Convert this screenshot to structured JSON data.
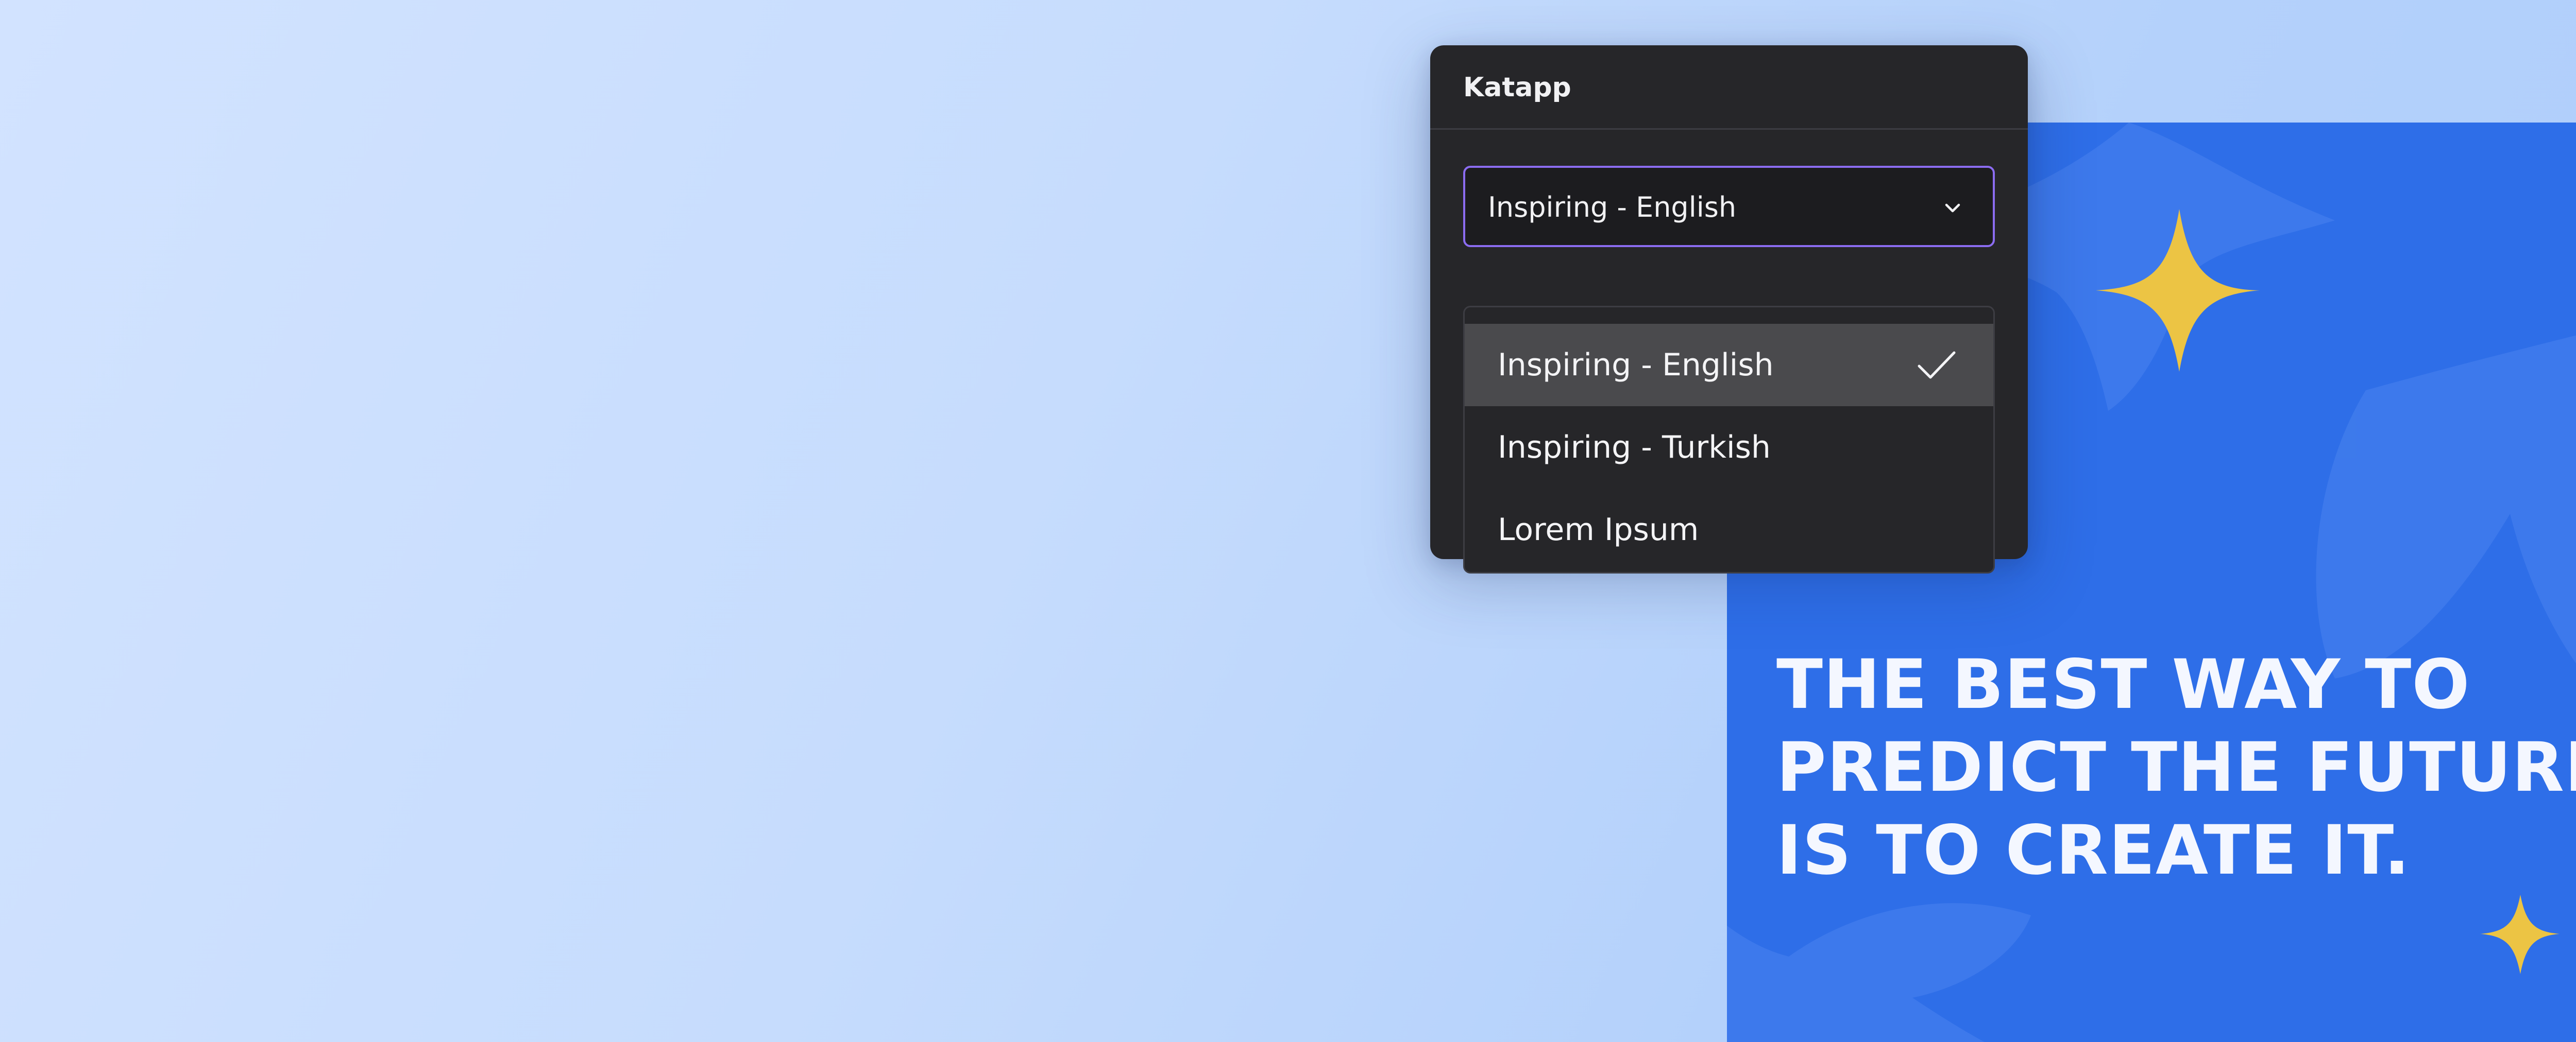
{
  "app": {
    "title": "Katapp"
  },
  "language_select": {
    "selected_value": "Inspiring - English",
    "chevron_icon": "chevron-down-icon",
    "accent_color": "#8b6cf0"
  },
  "dropdown": {
    "options": [
      {
        "label": "Inspiring - English",
        "selected": true,
        "icon": "check-icon"
      },
      {
        "label": "Inspiring - Turkish",
        "selected": false
      },
      {
        "label": "Lorem Ipsum",
        "selected": false
      }
    ]
  },
  "poster": {
    "quote_lines": [
      "THE BEST WAY TO",
      "PREDICT THE FUTURE",
      "IS TO CREATE IT."
    ],
    "background_color": "#2e6ee8",
    "star_color": "#ecc444",
    "decorations": [
      "star-icon",
      "star-icon",
      "flower-shape"
    ]
  }
}
